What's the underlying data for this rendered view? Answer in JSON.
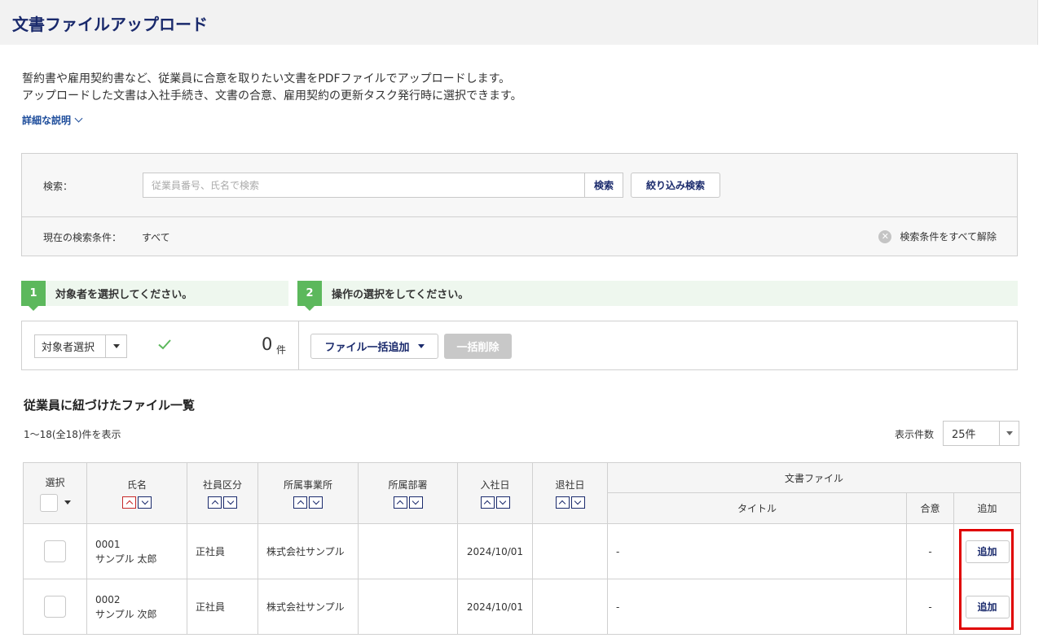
{
  "header": {
    "title": "文書ファイルアップロード"
  },
  "description": {
    "line1": "誓約書や雇用契約書など、従業員に合意を取りたい文書をPDFファイルでアップロードします。",
    "line2": "アップロードした文書は入社手続き、文書の合意、雇用契約の更新タスク発行時に選択できます。",
    "detail_link": "詳細な説明"
  },
  "search": {
    "label": "検索：",
    "placeholder": "従業員番号、氏名で検索",
    "search_button": "検索",
    "filter_button": "絞り込み検索",
    "condition_label": "現在の検索条件：",
    "condition_value": "すべて",
    "clear_label": "検索条件をすべて解除"
  },
  "steps": [
    {
      "num": "1",
      "text": "対象者を選択してください。"
    },
    {
      "num": "2",
      "text": "操作の選択をしてください。"
    }
  ],
  "actions": {
    "target_select": "対象者選択",
    "count": "0",
    "count_unit": "件",
    "bulk_add": "ファイル一括追加",
    "bulk_delete": "一括削除"
  },
  "list": {
    "title": "従業員に紐づけたファイル一覧",
    "count_text": "1〜18(全18)件を表示",
    "per_page_label": "表示件数",
    "per_page_value": "25件"
  },
  "table": {
    "headers": {
      "select": "選択",
      "name": "氏名",
      "employment_type": "社員区分",
      "office": "所属事業所",
      "department": "所属部署",
      "hire_date": "入社日",
      "leave_date": "退社日",
      "document_file": "文書ファイル",
      "title": "タイトル",
      "consent": "合意",
      "add": "追加"
    },
    "rows": [
      {
        "id": "0001",
        "name": "サンプル 太郎",
        "employment_type": "正社員",
        "office": "株式会社サンプル",
        "department": "",
        "hire_date": "2024/10/01",
        "leave_date": "",
        "title": "-",
        "consent": "-",
        "add_label": "追加"
      },
      {
        "id": "0002",
        "name": "サンプル 次郎",
        "employment_type": "正社員",
        "office": "株式会社サンプル",
        "department": "",
        "hire_date": "2024/10/01",
        "leave_date": "",
        "title": "-",
        "consent": "-",
        "add_label": "追加"
      }
    ]
  },
  "colors": {
    "brand_navy": "#1a2a6c",
    "step_green": "#5cb85c",
    "highlight_red": "#e00000"
  }
}
